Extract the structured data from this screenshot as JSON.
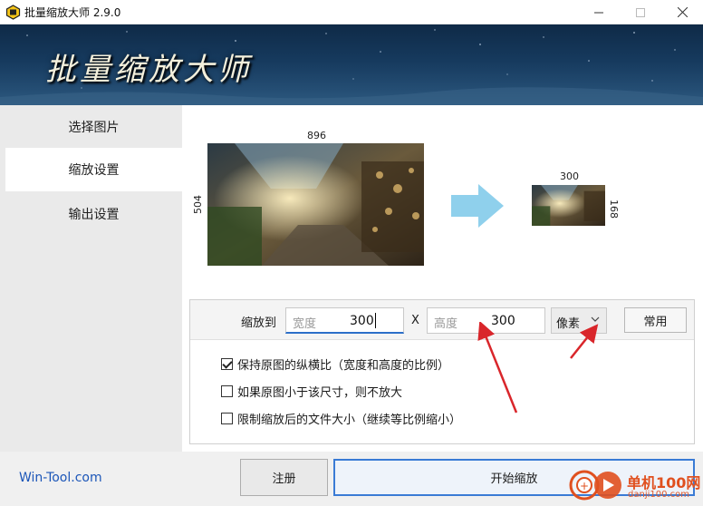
{
  "window": {
    "title": "批量缩放大师 2.9.0"
  },
  "banner": {
    "title": "批量缩放大师"
  },
  "sidebar": {
    "items": [
      {
        "label": "选择图片",
        "active": false
      },
      {
        "label": "缩放设置",
        "active": true
      },
      {
        "label": "输出设置",
        "active": false
      }
    ]
  },
  "preview": {
    "source_width": "896",
    "source_height": "504",
    "target_width": "300",
    "target_height": "168"
  },
  "scale_settings": {
    "label": "缩放到",
    "width_placeholder": "宽度",
    "width_value": "300",
    "separator": "X",
    "height_placeholder": "高度",
    "height_value": "300",
    "unit": "像素",
    "common_button": "常用"
  },
  "options": [
    {
      "label": "保持原图的纵横比（宽度和高度的比例）",
      "checked": true
    },
    {
      "label": "如果原图小于该尺寸，则不放大",
      "checked": false
    },
    {
      "label": "限制缩放后的文件大小（继续等比例缩小）",
      "checked": false
    }
  ],
  "footer": {
    "site_link": "Win-Tool.com",
    "register_button": "注册",
    "start_button": "开始缩放"
  },
  "watermark": {
    "line1": "单机100网",
    "line2": "danji100.com"
  },
  "colors": {
    "accent": "#3a7bd5",
    "link": "#1c56b8",
    "annotation": "#d9262b",
    "arrow": "#8fd0ec"
  }
}
